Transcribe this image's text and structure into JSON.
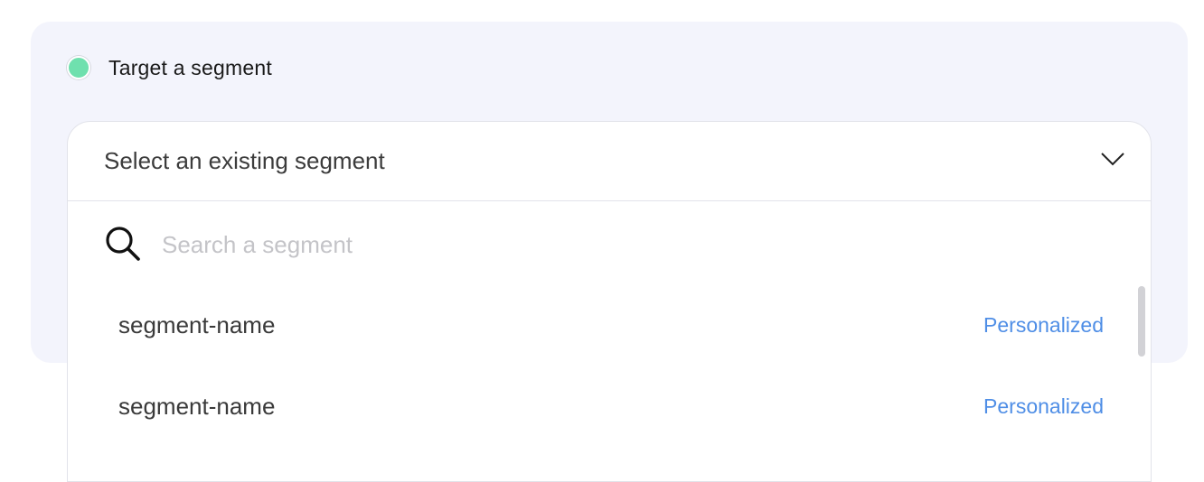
{
  "target": {
    "label": "Target a segment",
    "selected": true,
    "radio_color": "#6fe0ae"
  },
  "dropdown": {
    "header_label": "Select an existing segment",
    "search_placeholder": "Search a segment",
    "items": [
      {
        "name": "segment-name",
        "tag": "Personalized"
      },
      {
        "name": "segment-name",
        "tag": "Personalized"
      }
    ]
  },
  "colors": {
    "panel_bg": "#f3f4fc",
    "tag": "#4f8ee6"
  },
  "icons": {
    "search": "search-icon",
    "chevron": "chevron-down-icon"
  }
}
